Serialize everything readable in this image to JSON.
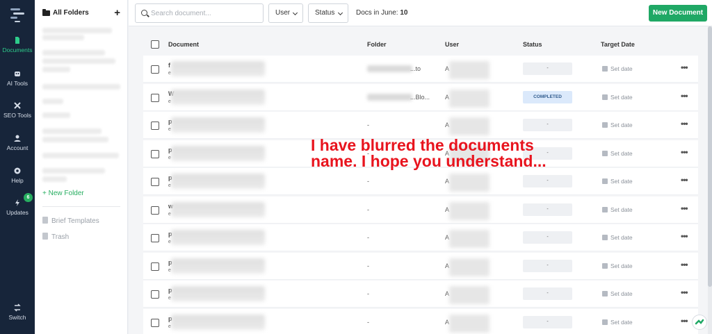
{
  "rail": {
    "items": [
      {
        "label": "Documents",
        "icon": "document-icon",
        "active": true
      },
      {
        "label": "AI Tools",
        "icon": "robot-icon",
        "active": false
      },
      {
        "label": "SEO Tools",
        "icon": "tools-icon",
        "active": false
      },
      {
        "label": "Account",
        "icon": "user-icon",
        "active": false
      },
      {
        "label": "Help",
        "icon": "help-icon",
        "active": false
      },
      {
        "label": "Updates",
        "icon": "bolt-icon",
        "active": false,
        "badge": "6"
      },
      {
        "label": "Switch",
        "icon": "switch-icon",
        "active": false
      }
    ]
  },
  "folders": {
    "title": "All Folders",
    "new_folder": "+ New Folder",
    "brief_templates": "Brief Templates",
    "trash": "Trash"
  },
  "topbar": {
    "search_placeholder": "Search document...",
    "user_filter": "User",
    "status_filter": "Status",
    "docs_label": "Docs in June: ",
    "docs_count": "10",
    "new_document": "New Document"
  },
  "table": {
    "headers": {
      "document": "Document",
      "folder": "Folder",
      "user": "User",
      "status": "Status",
      "target_date": "Target Date"
    },
    "rows": [
      {
        "doc_initial": "f",
        "doc_sub": "e",
        "folder": "...to",
        "user": "A",
        "status": "-",
        "date": "Set date"
      },
      {
        "doc_initial": "W",
        "doc_sub": "e",
        "folder": "...Blo...",
        "user": "A",
        "status": "COMPLETED",
        "date": "Set date"
      },
      {
        "doc_initial": "p",
        "doc_sub": "e",
        "folder": "-",
        "user": "A",
        "status": "-",
        "date": "Set date"
      },
      {
        "doc_initial": "p",
        "doc_sub": "e",
        "folder": "-",
        "user": "A",
        "status": "-",
        "date": "Set date"
      },
      {
        "doc_initial": "p",
        "doc_sub": "e",
        "folder": "-",
        "user": "A",
        "status": "-",
        "date": "Set date"
      },
      {
        "doc_initial": "w",
        "doc_sub": "e",
        "folder": "-",
        "user": "A",
        "status": "-",
        "date": "Set date"
      },
      {
        "doc_initial": "p",
        "doc_sub": "e",
        "folder": "-",
        "user": "A",
        "status": "-",
        "date": "Set date"
      },
      {
        "doc_initial": "p",
        "doc_sub": "e",
        "folder": "-",
        "user": "A",
        "status": "-",
        "date": "Set date"
      },
      {
        "doc_initial": "p",
        "doc_sub": "e",
        "folder": "-",
        "user": "A",
        "status": "-",
        "date": "Set date"
      },
      {
        "doc_initial": "p",
        "doc_sub": "e",
        "folder": "-",
        "user": "A",
        "status": "-",
        "date": "Set date"
      }
    ],
    "more_label": "•••"
  },
  "overlay_note": "I have blurred the documents name. I hope you understand...",
  "colors": {
    "rail_bg": "#17253a",
    "accent_green": "#1fa865",
    "overlay_red": "#e8141e",
    "completed_bg": "#dbe9fb"
  }
}
